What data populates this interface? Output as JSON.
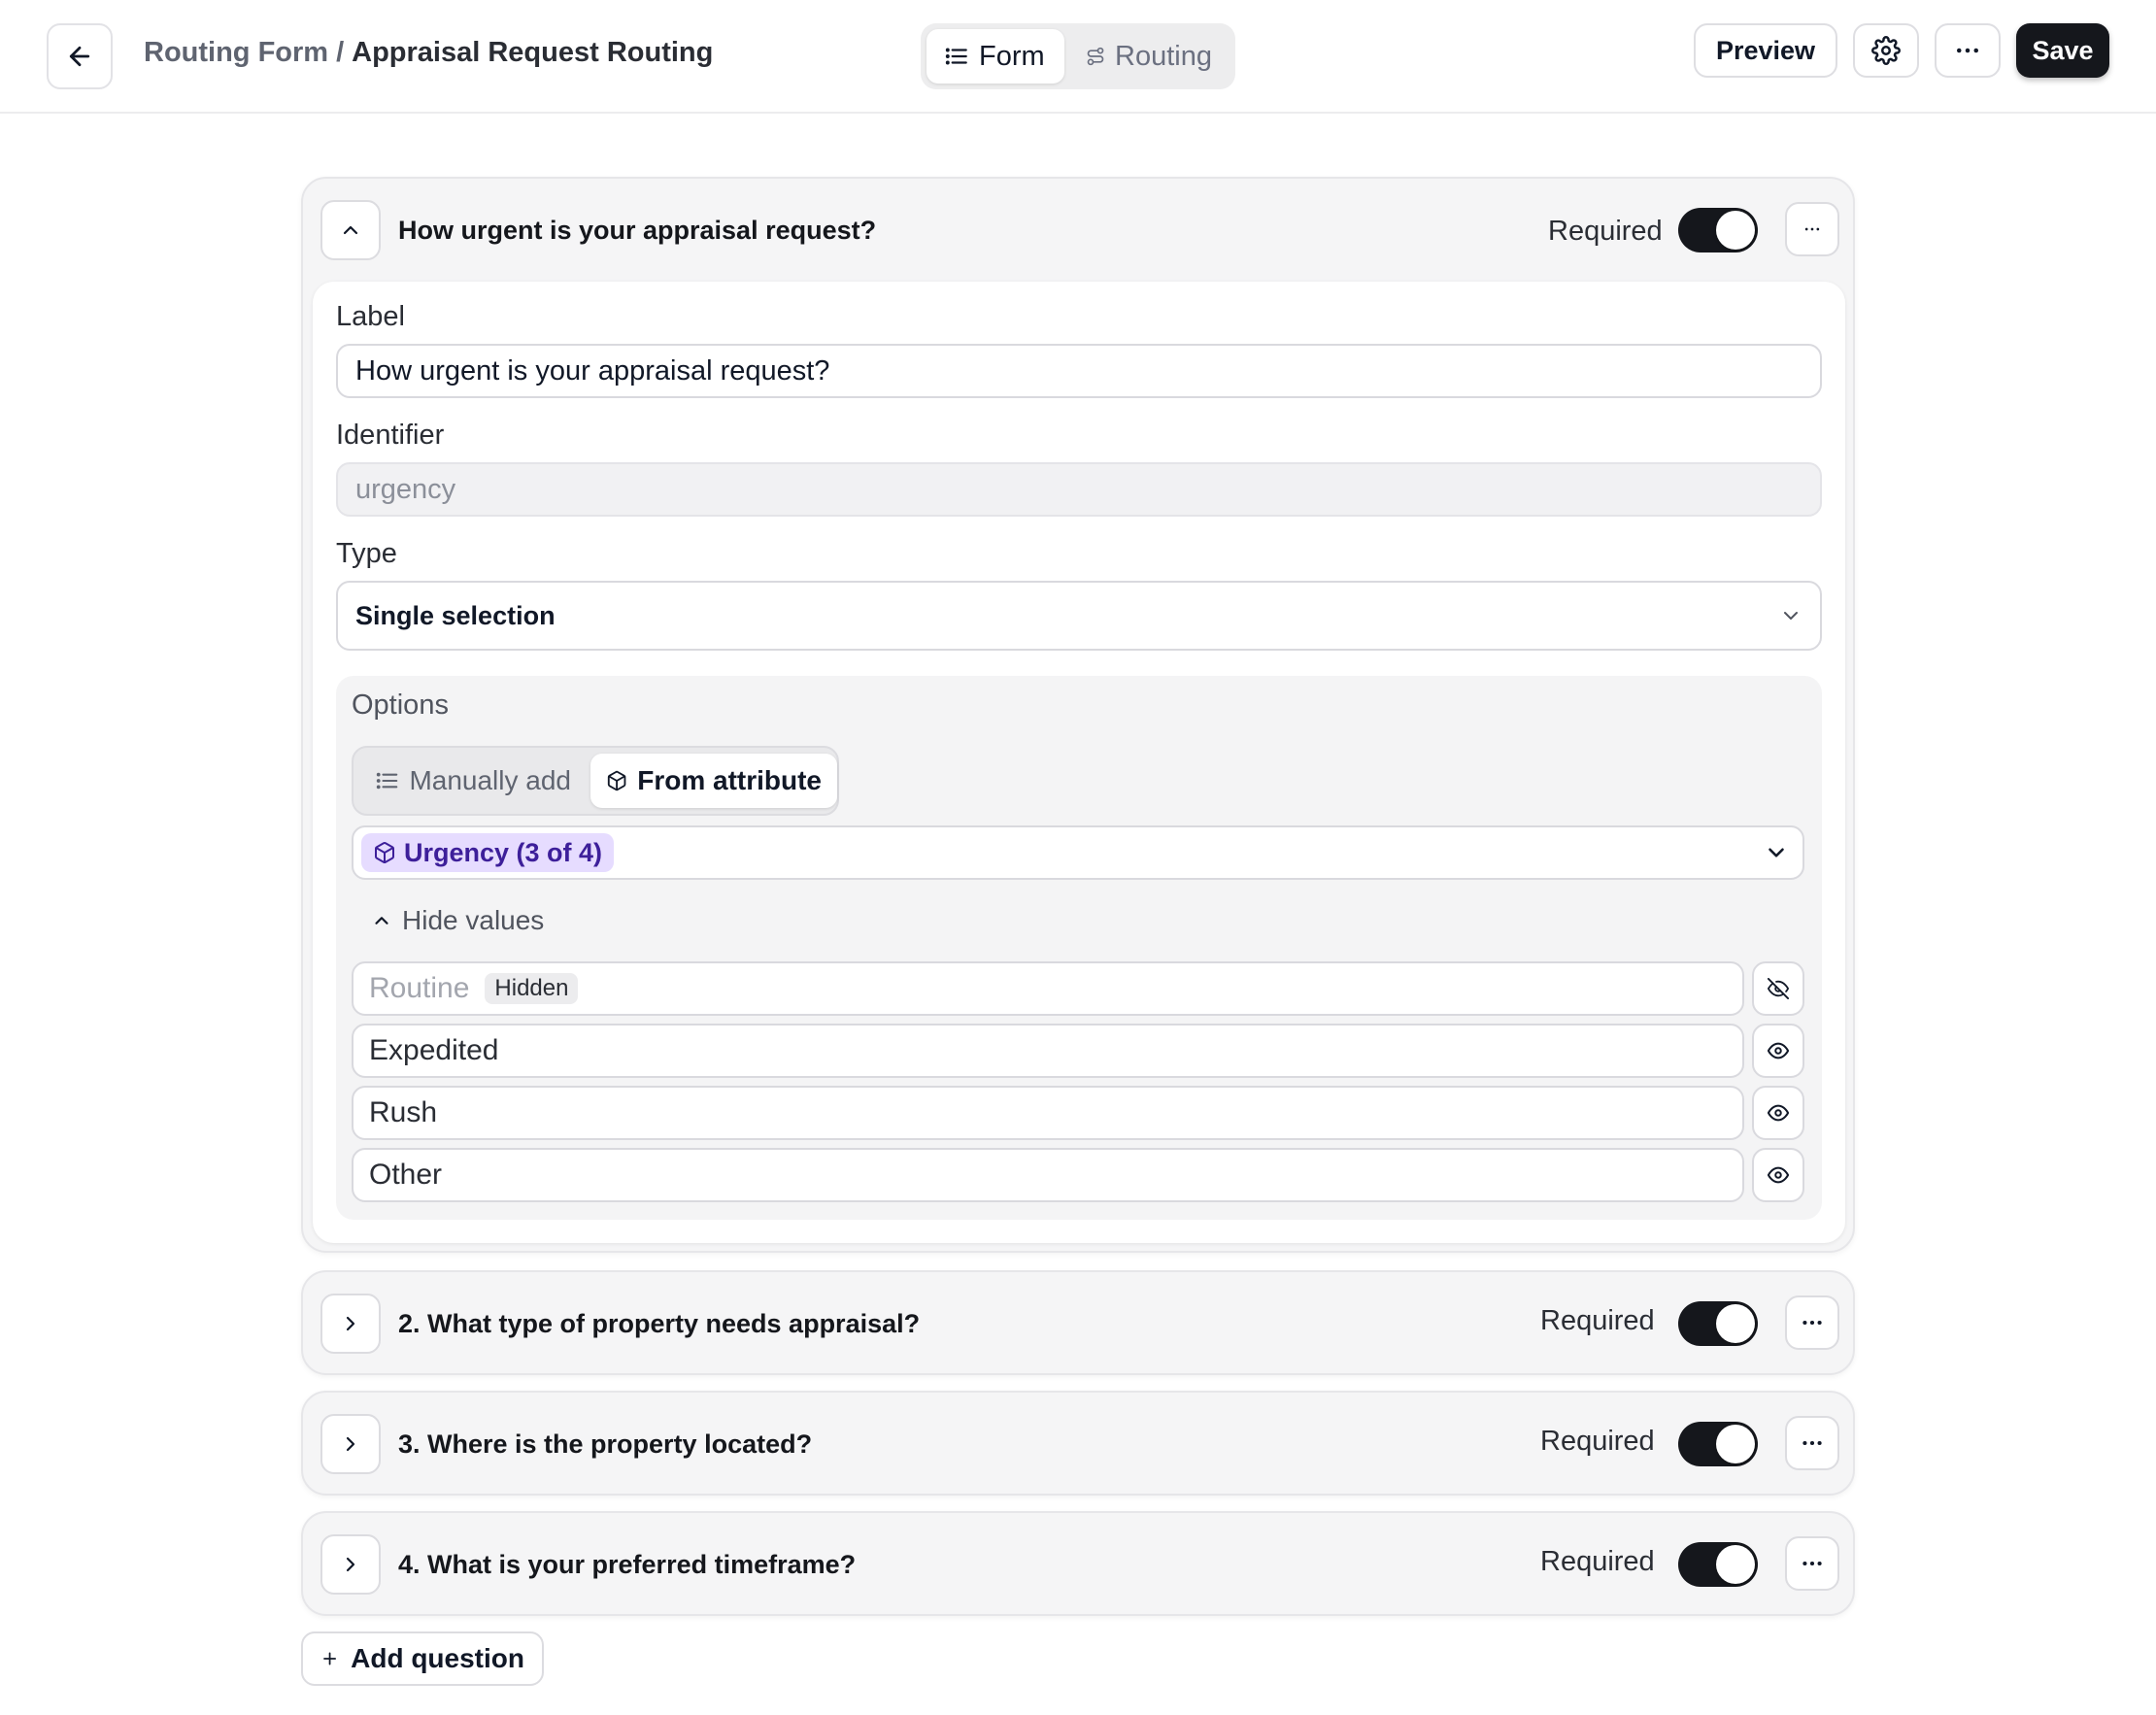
{
  "header": {
    "breadcrumb_parent": "Routing Form",
    "breadcrumb_separator": "/",
    "breadcrumb_current": "Appraisal Request Routing",
    "tabs": [
      {
        "label": "Form",
        "active": true
      },
      {
        "label": "Routing",
        "active": false
      }
    ],
    "preview_label": "Preview",
    "save_label": "Save"
  },
  "questions": [
    {
      "title": "How urgent is your appraisal request?",
      "required_label": "Required",
      "required": true,
      "expanded": true,
      "label_field": {
        "label": "Label",
        "value": "How urgent is your appraisal request?"
      },
      "identifier_field": {
        "label": "Identifier",
        "value": "urgency"
      },
      "type_field": {
        "label": "Type",
        "value": "Single selection"
      },
      "options": {
        "title": "Options",
        "source_tabs": [
          {
            "label": "Manually add",
            "active": false
          },
          {
            "label": "From attribute",
            "active": true
          }
        ],
        "attribute_chip": "Urgency (3 of 4)",
        "hide_values_label": "Hide values",
        "values": [
          {
            "label": "Routine",
            "hidden": true,
            "badge": "Hidden"
          },
          {
            "label": "Expedited",
            "hidden": false
          },
          {
            "label": "Rush",
            "hidden": false
          },
          {
            "label": "Other",
            "hidden": false
          }
        ]
      }
    },
    {
      "title": "2. What type of property needs appraisal?",
      "required_label": "Required",
      "required": true,
      "expanded": false
    },
    {
      "title": "3. Where is the property located?",
      "required_label": "Required",
      "required": true,
      "expanded": false
    },
    {
      "title": "4. What is your preferred timeframe?",
      "required_label": "Required",
      "required": true,
      "expanded": false
    }
  ],
  "add_question_label": "Add question",
  "colors": {
    "accent_dark": "#15171c",
    "chip_bg": "#e6dcff",
    "chip_text": "#3d1f9a"
  }
}
